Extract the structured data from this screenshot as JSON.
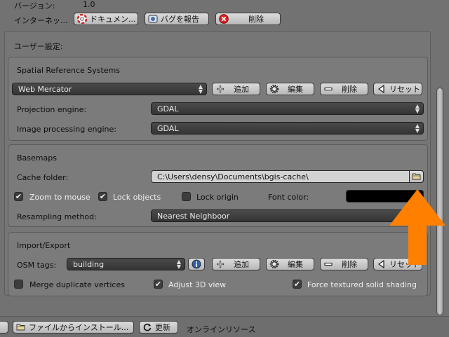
{
  "top": {
    "version_label": "バージョン:",
    "version_value": "1.0",
    "internet_label": "インターネッ...",
    "doc_button": "ドキュメン...",
    "report_bug_button": "バグを報告",
    "delete_button": "削除"
  },
  "prefs": {
    "title": "ユーザー設定:",
    "srs": {
      "title": "Spatial Reference Systems",
      "selected": "Web Mercator",
      "add": "追加",
      "edit": "編集",
      "remove": "削除",
      "reset": "リセット",
      "proj_label": "Projection engine:",
      "proj_value": "GDAL",
      "img_label": "Image processing engine:",
      "img_value": "GDAL"
    },
    "basemaps": {
      "title": "Basemaps",
      "cache_label": "Cache folder:",
      "cache_value": "C:\\Users\\densy\\Documents\\bgis-cache\\",
      "zoom_label": "Zoom to mouse",
      "zoom_checked": true,
      "lock_objects_label": "Lock objects",
      "lock_objects_checked": true,
      "lock_origin_label": "Lock origin",
      "lock_origin_checked": false,
      "font_color_label": "Font color:",
      "font_color": "#000000",
      "resampling_label": "Resampling method:",
      "resampling_value": "Nearest Neighboor"
    },
    "import_export": {
      "title": "Import/Export",
      "osm_label": "OSM tags:",
      "osm_value": "building",
      "add": "追加",
      "edit": "編集",
      "remove": "削除",
      "reset": "リセット",
      "merge_label": "Merge duplicate vertices",
      "merge_checked": false,
      "adjust_label": "Adjust 3D view",
      "adjust_checked": true,
      "force_label": "Force textured solid shading",
      "force_checked": true
    }
  },
  "bottom": {
    "install_button": "ファイルからインストール...",
    "refresh_button": "更新",
    "online_label": "オンラインリソース"
  },
  "overlay": {
    "arrow_color": "#ff7f00"
  }
}
